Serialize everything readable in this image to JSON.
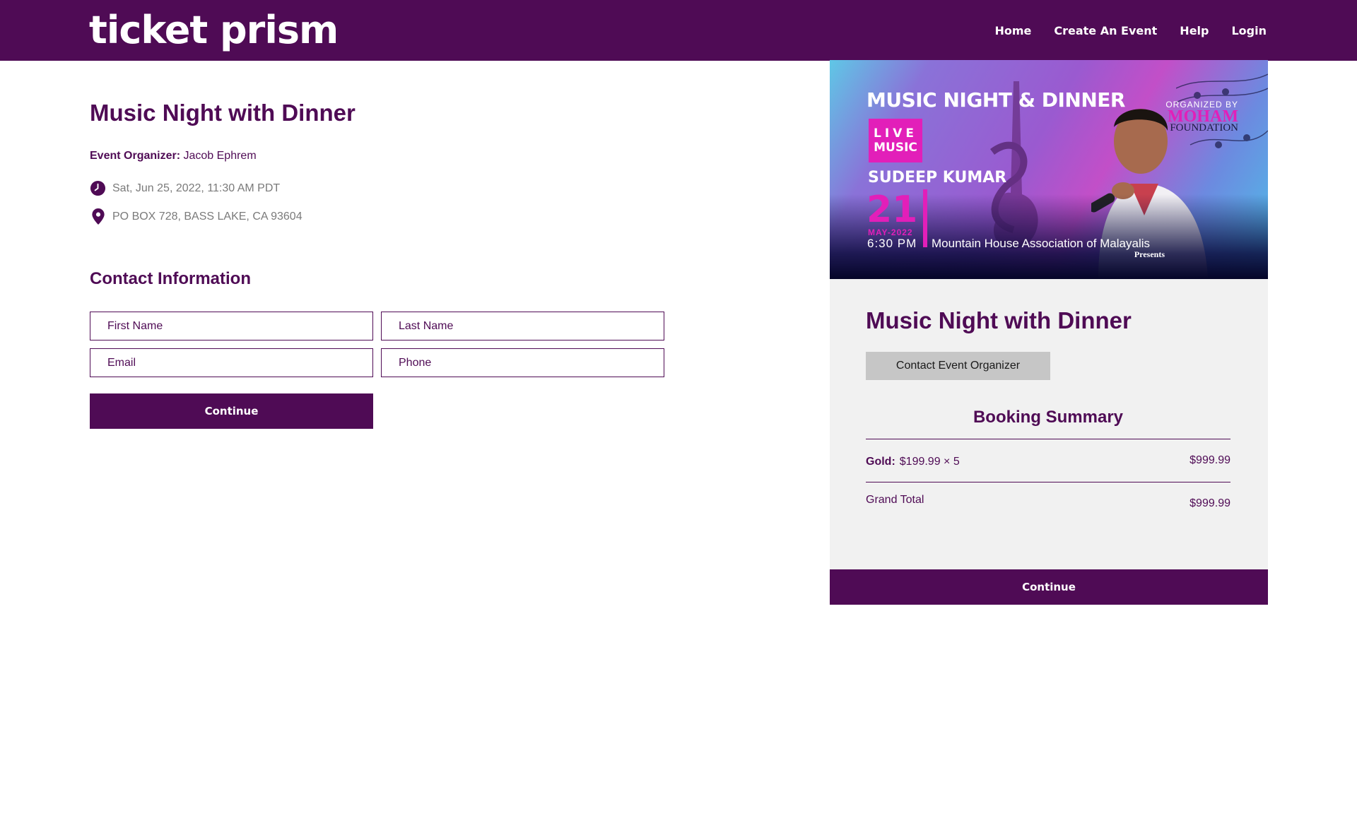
{
  "header": {
    "logo": "ticket prism",
    "nav": [
      "Home",
      "Create An Event",
      "Help",
      "Login"
    ]
  },
  "event": {
    "title": "Music Night with Dinner",
    "organizer_label": "Event Organizer:",
    "organizer_name": "Jacob Ephrem",
    "datetime": "Sat, Jun 25, 2022, 11:30 AM PDT",
    "location": "PO BOX 728, BASS LAKE, CA 93604"
  },
  "contact": {
    "title": "Contact Information",
    "first_name_placeholder": "First Name",
    "last_name_placeholder": "Last Name",
    "email_placeholder": "Email",
    "phone_placeholder": "Phone",
    "continue_label": "Continue"
  },
  "banner": {
    "title": "MUSIC NIGHT & DINNER",
    "organized_by": "ORGANIZED BY",
    "org_name": "MOHAM",
    "org_sub": "FOUNDATION",
    "live_line1": "LIVE",
    "live_line2": "MUSIC",
    "artist": "SUDEEP KUMAR",
    "day": "21",
    "month": "MAY-2022",
    "time": "6:30 PM",
    "association": "Mountain House Association of Malayalis",
    "presents": "Presents"
  },
  "summary_panel": {
    "title": "Music Night with Dinner",
    "contact_button": "Contact Event Organizer",
    "booking_title": "Booking Summary",
    "item_tier": "Gold:",
    "item_price_qty": "$199.99 × 5",
    "item_amount": "$999.99",
    "grand_total_label": "Grand Total",
    "grand_total_amount": "$999.99",
    "continue_label": "Continue"
  },
  "colors": {
    "brand_purple": "#4f0b55",
    "accent_pink": "#e21fb9",
    "panel_bg": "#f1f1f1",
    "button_gray": "#c6c6c6"
  }
}
